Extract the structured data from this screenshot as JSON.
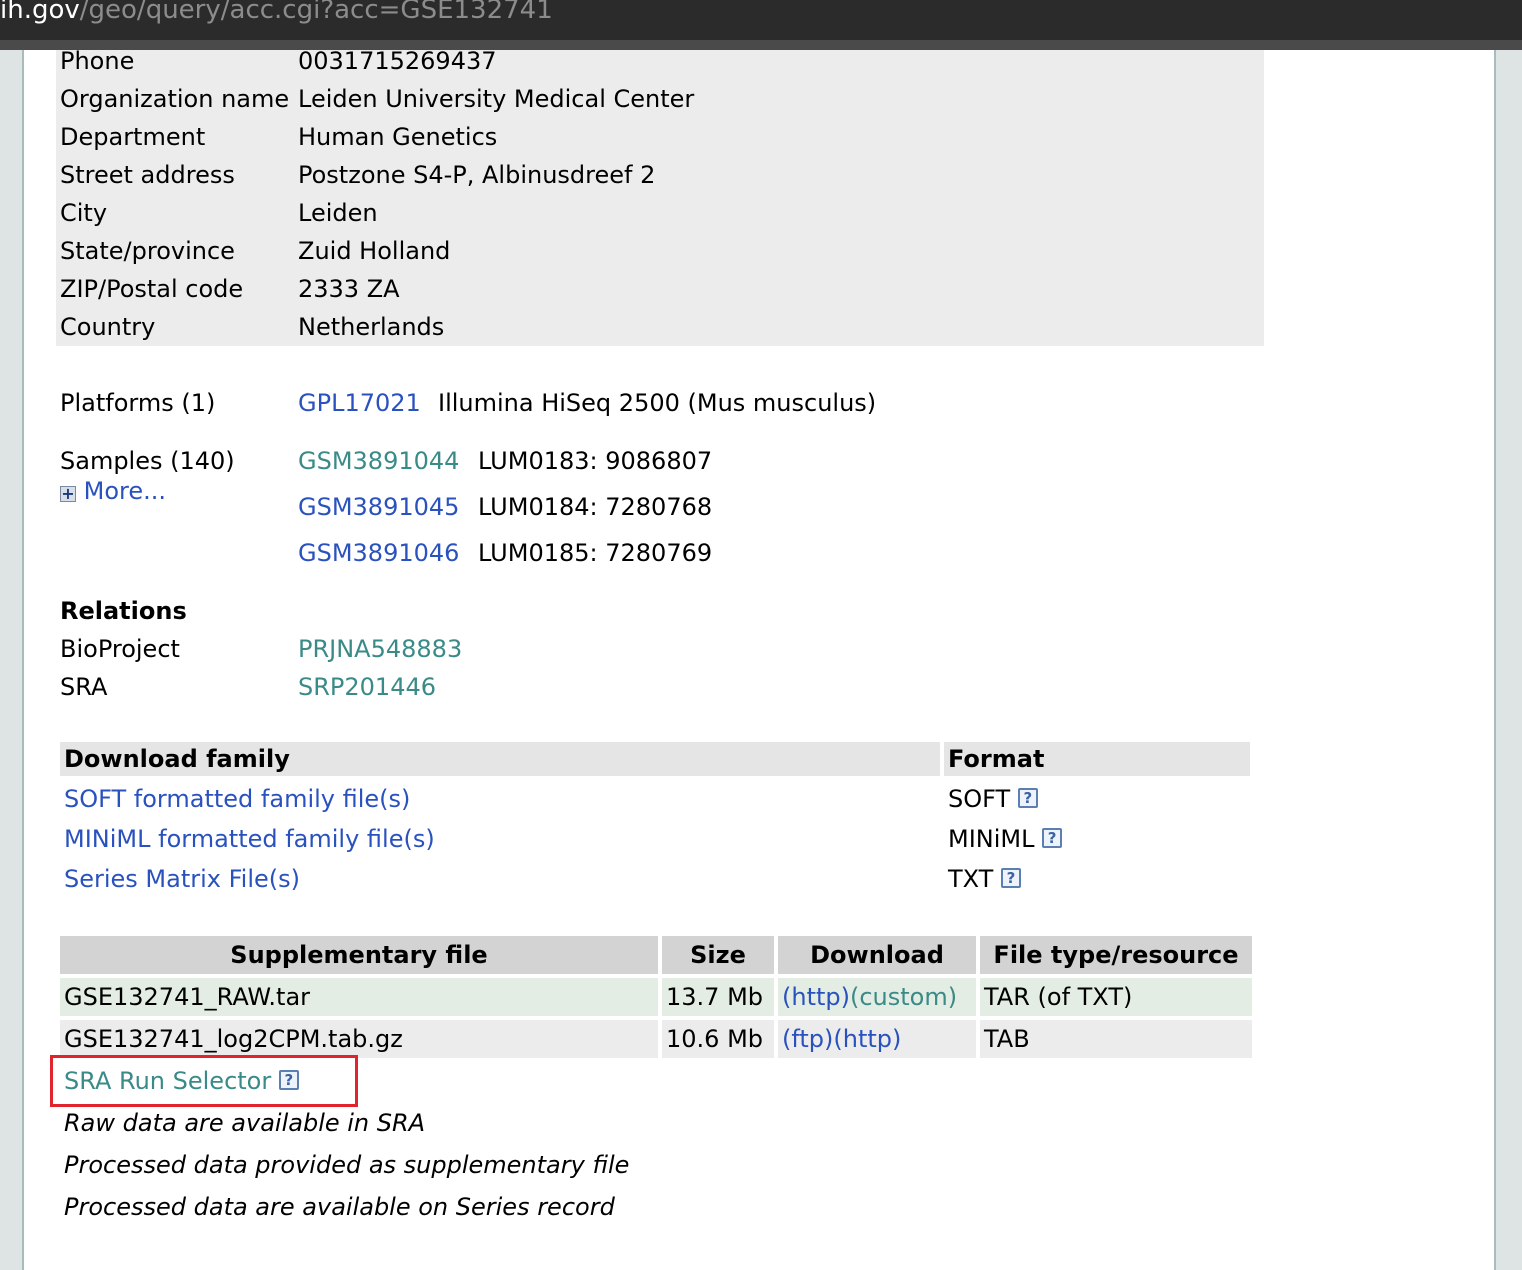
{
  "browser": {
    "url_host": "ih.gov",
    "url_path": "/geo/query/acc.cgi?acc=GSE132741"
  },
  "contact": {
    "rows": [
      {
        "label": "Phone",
        "value": "0031715269437"
      },
      {
        "label": "Organization name",
        "value": "Leiden University Medical Center"
      },
      {
        "label": "Department",
        "value": "Human Genetics"
      },
      {
        "label": "Street address",
        "value": "Postzone S4-P, Albinusdreef 2"
      },
      {
        "label": "City",
        "value": "Leiden"
      },
      {
        "label": "State/province",
        "value": "Zuid Holland"
      },
      {
        "label": "ZIP/Postal code",
        "value": "2333 ZA"
      },
      {
        "label": "Country",
        "value": "Netherlands"
      }
    ]
  },
  "platforms": {
    "label": "Platforms (1)",
    "accession": "GPL17021",
    "description": "Illumina HiSeq 2500 (Mus musculus)"
  },
  "samples": {
    "label": "Samples (140)",
    "more_label": "More...",
    "items": [
      {
        "accession": "GSM3891044",
        "title": "LUM0183: 9086807"
      },
      {
        "accession": "GSM3891045",
        "title": "LUM0184: 7280768"
      },
      {
        "accession": "GSM3891046",
        "title": "LUM0185: 7280769"
      }
    ]
  },
  "relations": {
    "heading": "Relations",
    "items": [
      {
        "label": "BioProject",
        "value": "PRJNA548883"
      },
      {
        "label": "SRA",
        "value": "SRP201446"
      }
    ]
  },
  "download_family": {
    "headers": {
      "family": "Download family",
      "format": "Format"
    },
    "rows": [
      {
        "name": "SOFT formatted family file(s)",
        "format": "SOFT"
      },
      {
        "name": "MINiML formatted family file(s)",
        "format": "MINiML"
      },
      {
        "name": "Series Matrix File(s)",
        "format": "TXT"
      }
    ]
  },
  "supplementary": {
    "headers": {
      "file": "Supplementary file",
      "size": "Size",
      "download": "Download",
      "type": "File type/resource"
    },
    "rows": [
      {
        "file": "GSE132741_RAW.tar",
        "size": "13.7 Mb",
        "link1": "(http)",
        "link2": "(custom)",
        "type": "TAR (of TXT)"
      },
      {
        "file": "GSE132741_log2CPM.tab.gz",
        "size": "10.6 Mb",
        "link1": "(ftp)",
        "link2": "(http)",
        "type": "TAB"
      }
    ]
  },
  "sra_run_selector": {
    "label": "SRA Run Selector"
  },
  "help_icon_glyph": "?",
  "notes": [
    "Raw data are available in SRA",
    "Processed data provided as supplementary file",
    "Processed data are available on Series record"
  ],
  "colors": {
    "link_blue": "#2a52be",
    "link_teal": "#3a8a88",
    "highlight_box": "#e0242e"
  }
}
